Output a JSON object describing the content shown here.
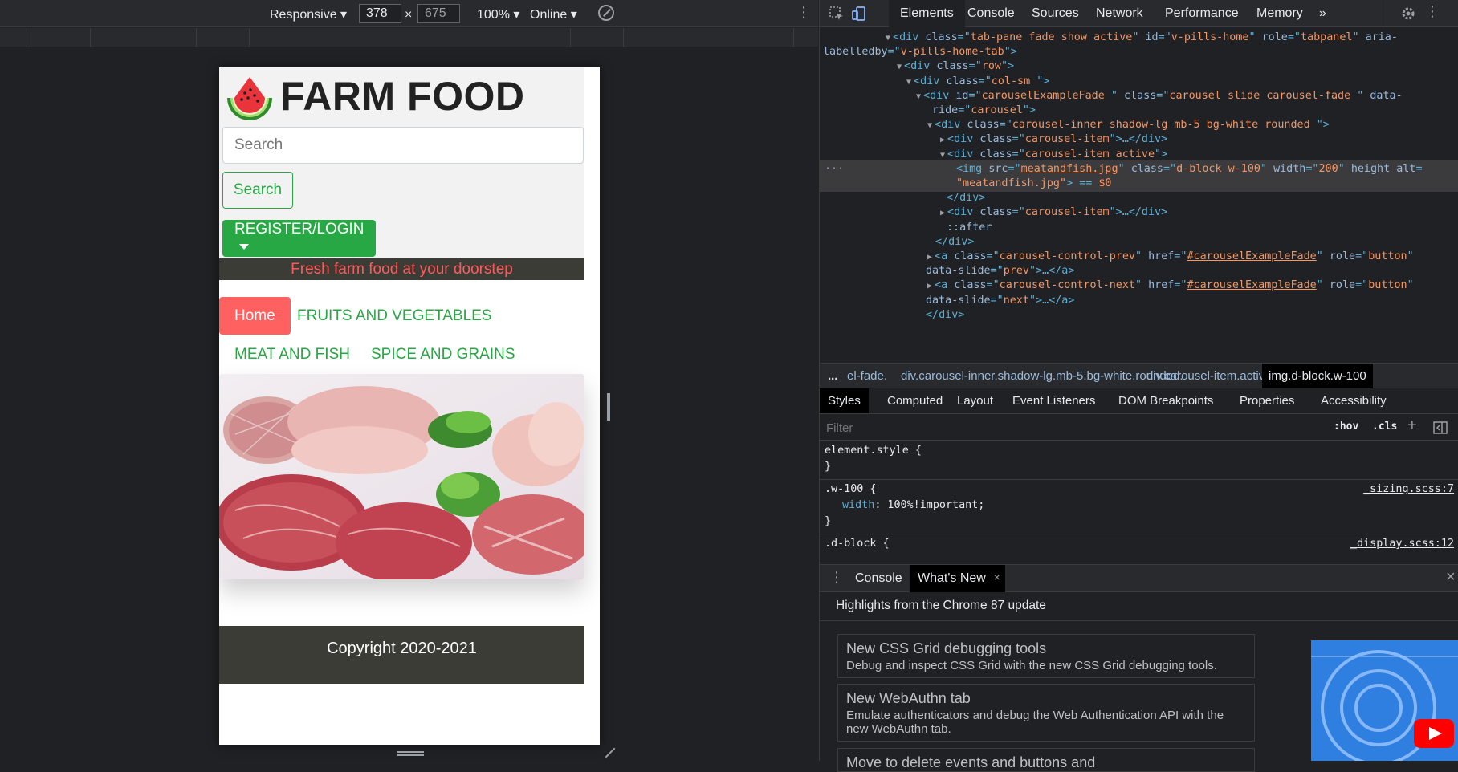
{
  "device_toolbar": {
    "device": "Responsive",
    "width": "378",
    "times": "×",
    "height": "675",
    "zoom": "100%",
    "throttle": "Online"
  },
  "site": {
    "brand": "FARM FOOD",
    "search_placeholder": "Search",
    "search_button": "Search",
    "register_button": "REGISTER/LOGIN",
    "tagline": "Fresh farm food at your doorstep",
    "nav": {
      "home": "Home",
      "fruits": "FRUITS AND VEGETABLES",
      "meat": "MEAT AND FISH",
      "spice": "SPICE AND GRAINS"
    },
    "footer": "Copyright 2020-2021",
    "colors": {
      "green": "#28a745",
      "red": "#ff6060",
      "dark": "#3c3c37"
    }
  },
  "devtools": {
    "tabs": [
      "Elements",
      "Console",
      "Sources",
      "Network",
      "Performance",
      "Memory",
      "»"
    ],
    "active_tab": "Elements",
    "dom_lines": [
      {
        "pre": "▼",
        "parts": [
          [
            "tg",
            "<div "
          ],
          [
            "an",
            "class"
          ],
          [
            "tg",
            "=\""
          ],
          [
            "av",
            "tab-pane fade show active"
          ],
          [
            "tg",
            "\" "
          ],
          [
            "an",
            "id"
          ],
          [
            "tg",
            "=\""
          ],
          [
            "av",
            "v-pills-home"
          ],
          [
            "tg",
            "\" "
          ],
          [
            "an",
            "role"
          ],
          [
            "tg",
            "=\""
          ],
          [
            "av",
            "tabpanel"
          ],
          [
            "tg",
            "\" "
          ],
          [
            "an",
            "aria-"
          ]
        ]
      },
      {
        "pre": "",
        "parts": [
          [
            "an",
            "labelledby"
          ],
          [
            "tg",
            "=\""
          ],
          [
            "av",
            "v-pills-home-tab"
          ],
          [
            "tg",
            "\">"
          ]
        ]
      },
      {
        "pre": "▼",
        "parts": [
          [
            "tg",
            "<div "
          ],
          [
            "an",
            "class"
          ],
          [
            "tg",
            "=\""
          ],
          [
            "av",
            "row"
          ],
          [
            "tg",
            "\">"
          ]
        ]
      },
      {
        "pre": "▼",
        "parts": [
          [
            "tg",
            "<div "
          ],
          [
            "an",
            "class"
          ],
          [
            "tg",
            "=\""
          ],
          [
            "av",
            "col-sm "
          ],
          [
            "tg",
            "\">"
          ]
        ]
      },
      {
        "pre": "▼",
        "parts": [
          [
            "tg",
            "<div "
          ],
          [
            "an",
            "id"
          ],
          [
            "tg",
            "=\""
          ],
          [
            "av",
            "carouselExampleFade "
          ],
          [
            "tg",
            "\" "
          ],
          [
            "an",
            "class"
          ],
          [
            "tg",
            "=\""
          ],
          [
            "av",
            "carousel slide carousel-fade "
          ],
          [
            "tg",
            "\" "
          ],
          [
            "an",
            "data-"
          ]
        ]
      },
      {
        "pre": "",
        "parts": [
          [
            "an",
            "ride"
          ],
          [
            "tg",
            "=\""
          ],
          [
            "av",
            "carousel"
          ],
          [
            "tg",
            "\">"
          ]
        ]
      },
      {
        "pre": "▼",
        "parts": [
          [
            "tg",
            "<div "
          ],
          [
            "an",
            "class"
          ],
          [
            "tg",
            "=\""
          ],
          [
            "av",
            "carousel-inner shadow-lg mb-5 bg-white rounded "
          ],
          [
            "tg",
            "\">"
          ]
        ]
      },
      {
        "pre": "▶",
        "parts": [
          [
            "tg",
            "<div "
          ],
          [
            "an",
            "class"
          ],
          [
            "tg",
            "=\""
          ],
          [
            "av",
            "carousel-item"
          ],
          [
            "tg",
            "\">…</div>"
          ]
        ]
      },
      {
        "pre": "▼",
        "parts": [
          [
            "tg",
            "<div "
          ],
          [
            "an",
            "class"
          ],
          [
            "tg",
            "=\""
          ],
          [
            "av",
            "carousel-item active"
          ],
          [
            "tg",
            "\">"
          ]
        ]
      },
      {
        "pre": "",
        "parts": [
          [
            "tg",
            "<img "
          ],
          [
            "an",
            "src"
          ],
          [
            "tg",
            "=\""
          ],
          [
            "lk",
            "meatandfish.jpg"
          ],
          [
            "tg",
            "\" "
          ],
          [
            "an",
            "class"
          ],
          [
            "tg",
            "=\""
          ],
          [
            "av",
            "d-block w-100"
          ],
          [
            "tg",
            "\" "
          ],
          [
            "an",
            "width"
          ],
          [
            "tg",
            "=\""
          ],
          [
            "av",
            "200"
          ],
          [
            "tg",
            "\" "
          ],
          [
            "an",
            "height alt"
          ],
          [
            "tg",
            "="
          ]
        ]
      },
      {
        "pre": "",
        "parts": [
          [
            "av",
            "\"meatandfish.jpg\""
          ],
          [
            "tg",
            "> "
          ],
          [
            "",
            ""
          ],
          [
            "tg",
            "== "
          ],
          [
            "av",
            "$0"
          ]
        ]
      },
      {
        "pre": "",
        "parts": [
          [
            "tg",
            "</div>"
          ]
        ]
      },
      {
        "pre": "▶",
        "parts": [
          [
            "tg",
            "<div "
          ],
          [
            "an",
            "class"
          ],
          [
            "tg",
            "=\""
          ],
          [
            "av",
            "carousel-item"
          ],
          [
            "tg",
            "\">…</div>"
          ]
        ]
      },
      {
        "pre": "",
        "parts": [
          [
            "an",
            "::after"
          ]
        ]
      },
      {
        "pre": "",
        "parts": [
          [
            "tg",
            "</div>"
          ]
        ]
      },
      {
        "pre": "▶",
        "parts": [
          [
            "tg",
            "<a "
          ],
          [
            "an",
            "class"
          ],
          [
            "tg",
            "=\""
          ],
          [
            "av",
            "carousel-control-prev"
          ],
          [
            "tg",
            "\" "
          ],
          [
            "an",
            "href"
          ],
          [
            "tg",
            "=\""
          ],
          [
            "lk",
            "#carouselExampleFade"
          ],
          [
            "tg",
            "\" "
          ],
          [
            "an",
            "role"
          ],
          [
            "tg",
            "=\""
          ],
          [
            "av",
            "button"
          ],
          [
            "tg",
            "\""
          ]
        ]
      },
      {
        "pre": "",
        "parts": [
          [
            "an",
            "data-slide"
          ],
          [
            "tg",
            "=\""
          ],
          [
            "av",
            "prev"
          ],
          [
            "tg",
            "\">…</a>"
          ]
        ]
      },
      {
        "pre": "▶",
        "parts": [
          [
            "tg",
            "<a "
          ],
          [
            "an",
            "class"
          ],
          [
            "tg",
            "=\""
          ],
          [
            "av",
            "carousel-control-next"
          ],
          [
            "tg",
            "\" "
          ],
          [
            "an",
            "href"
          ],
          [
            "tg",
            "=\""
          ],
          [
            "lk",
            "#carouselExampleFade"
          ],
          [
            "tg",
            "\" "
          ],
          [
            "an",
            "role"
          ],
          [
            "tg",
            "=\""
          ],
          [
            "av",
            "button"
          ],
          [
            "tg",
            "\""
          ]
        ]
      },
      {
        "pre": "",
        "parts": [
          [
            "an",
            "data-slide"
          ],
          [
            "tg",
            "=\""
          ],
          [
            "av",
            "next"
          ],
          [
            "tg",
            "\">…</a>"
          ]
        ]
      },
      {
        "pre": "",
        "parts": [
          [
            "tg",
            "</div>"
          ]
        ]
      }
    ],
    "breadcrumbs": [
      "...",
      "el-fade.",
      "div.carousel-inner.shadow-lg.mb-5.bg-white.rounded.",
      "div.carousel-item.active",
      "img.d-block.w-100"
    ],
    "style_tabs": [
      "Styles",
      "Computed",
      "Layout",
      "Event Listeners",
      "DOM Breakpoints",
      "Properties",
      "Accessibility"
    ],
    "filter_placeholder": "Filter",
    "hov": ":hov",
    "cls": ".cls",
    "styles": {
      "element_style": "element.style {",
      "close": "}",
      "w100_sel": ".w-100 {",
      "w100_prop": "width",
      "w100_val": ": 100%!important;",
      "w100_src": "_sizing.scss:7",
      "dblock_sel": ".d-block {",
      "dblock_src": "_display.scss:12"
    },
    "drawer_tabs": [
      "Console",
      "What's New"
    ],
    "drawer_close": "×",
    "highlights": "Highlights from the Chrome 87 update",
    "cards": [
      {
        "title": "New CSS Grid debugging tools",
        "desc": "Debug and inspect CSS Grid with the new CSS Grid debugging tools."
      },
      {
        "title": "New WebAuthn tab",
        "desc": "Emulate authenticators and debug the Web Authentication API with the new WebAuthn tab."
      },
      {
        "title": "Move to delete events and buttons and",
        "desc": ""
      }
    ]
  }
}
